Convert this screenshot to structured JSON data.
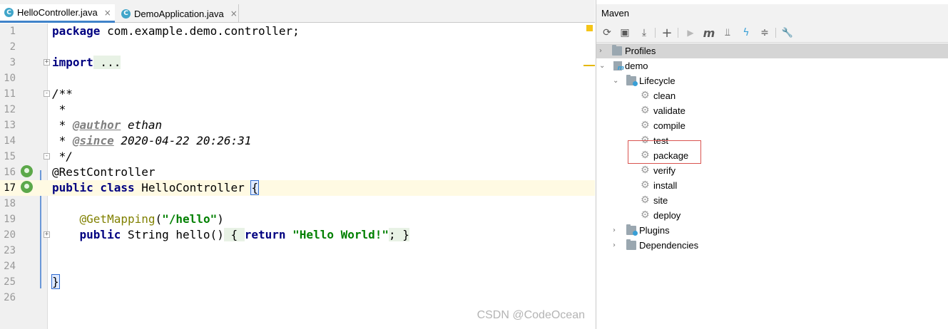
{
  "editor": {
    "tabs": [
      {
        "label": "HelloController.java",
        "active": true
      },
      {
        "label": "DemoApplication.java",
        "active": false
      }
    ],
    "close_glyph": "×",
    "lines": [
      {
        "num": "1"
      },
      {
        "num": "2"
      },
      {
        "num": "3"
      },
      {
        "num": "10"
      },
      {
        "num": "11"
      },
      {
        "num": "12"
      },
      {
        "num": "13"
      },
      {
        "num": "14"
      },
      {
        "num": "15"
      },
      {
        "num": "16"
      },
      {
        "num": "17"
      },
      {
        "num": "18"
      },
      {
        "num": "19"
      },
      {
        "num": "20"
      },
      {
        "num": "23"
      },
      {
        "num": "24"
      },
      {
        "num": "25"
      },
      {
        "num": "26"
      }
    ],
    "code": {
      "kw_package": "package",
      "package_name": " com.example.demo.controller;",
      "kw_import": "import",
      "import_fold": " ...",
      "doc_open": "/**",
      "doc_star": " *",
      "doc_star_sp": " * ",
      "author_tag": "@author",
      "author_value": " ethan",
      "since_tag": "@since",
      "since_value": " 2020-04-22 20:26:31",
      "doc_close": " */",
      "rest_annotation": "@RestController",
      "kw_public": "public",
      "kw_class": " class",
      "class_name": " HelloController ",
      "open_brace": "{",
      "indent": "    ",
      "get_mapping": "@GetMapping",
      "paren_open": "(",
      "mapping_path": "\"/hello\"",
      "paren_close": ")",
      "method_sig": " String hello()",
      "method_body_open": " { ",
      "kw_return": "return",
      "return_str": " \"Hello World!\"",
      "method_body_close": "; }",
      "close_brace": "}"
    }
  },
  "maven": {
    "title": "Maven",
    "tree": {
      "profiles": "Profiles",
      "project": "demo",
      "lifecycle": "Lifecycle",
      "phases": [
        "clean",
        "validate",
        "compile",
        "test",
        "package",
        "verify",
        "install",
        "site",
        "deploy"
      ],
      "plugins": "Plugins",
      "dependencies": "Dependencies"
    },
    "toolbar_glyphs": {
      "reload": "⟳",
      "reimport": "▣",
      "download": "⤓",
      "add": "+",
      "run": "▶",
      "execute": "m",
      "skip_tests": "⫫",
      "offline": "ϟ",
      "collapse": "≑",
      "settings": "🔧"
    },
    "arrow_right": "›",
    "arrow_down": "⌄",
    "gear_glyph": "⚙",
    "module_badge": "m"
  },
  "watermark": "CSDN @CodeOcean",
  "colors": {
    "keyword": "#000080",
    "annotation": "#808000",
    "string": "#008000",
    "comment": "#808080",
    "current_line": "#fffae3",
    "highlight_border": "#d9534f"
  }
}
